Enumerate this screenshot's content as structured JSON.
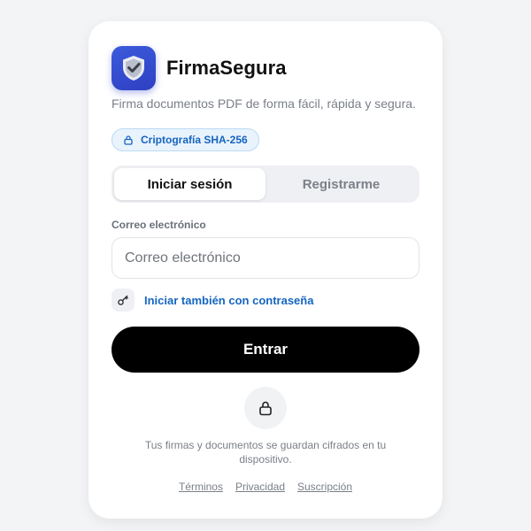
{
  "app": {
    "name": "FirmaSegura",
    "tagline": "Firma documentos PDF de forma fácil, rápida y segura.",
    "icon": "shield-check-icon",
    "accent_color": "#2f3fc4"
  },
  "badge": {
    "label": "Criptografía SHA-256",
    "icon": "lock-icon",
    "color": "#1565c0"
  },
  "tabs": [
    {
      "label": "Iniciar sesión",
      "active": true
    },
    {
      "label": "Registrarme",
      "active": false
    }
  ],
  "form": {
    "email_label": "Correo electrónico",
    "email_placeholder": "Correo electrónico",
    "email_value": "",
    "password_option_label": "Iniciar también con contraseña",
    "password_option_icon": "key-icon",
    "submit_label": "Entrar"
  },
  "security": {
    "icon": "lock-icon",
    "note": "Tus firmas y documentos se guardan cifrados en tu dispositivo."
  },
  "footer": {
    "links": [
      "Términos",
      "Privacidad",
      "Suscripción"
    ]
  }
}
